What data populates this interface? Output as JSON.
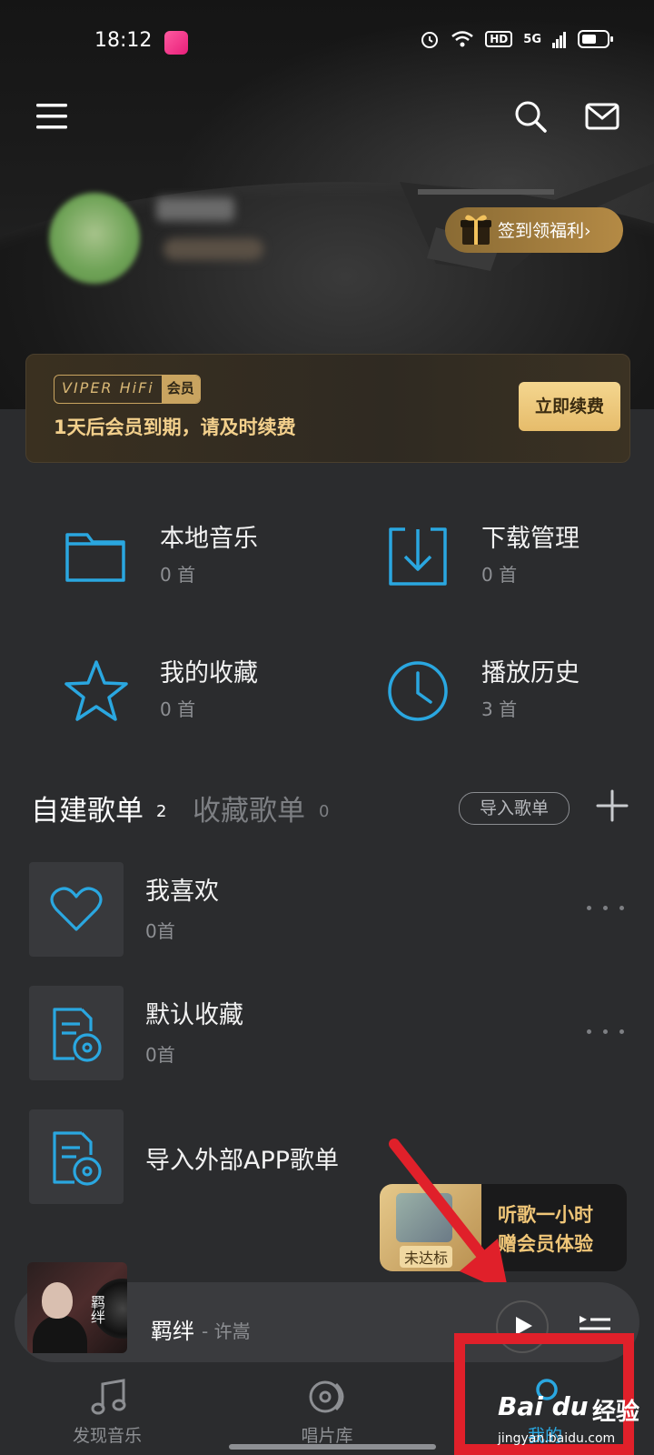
{
  "status_bar": {
    "time": "18:12",
    "hd_label": "HD",
    "network_label": "5G"
  },
  "user": {
    "checkin_label": "签到领福利"
  },
  "vip": {
    "logo_text": "VIPER HiFi",
    "logo_badge": "会员",
    "expiry_text": "1天后会员到期，请及时续费",
    "renew_label": "立即续费"
  },
  "quick_access": [
    {
      "title": "本地音乐",
      "count": "0 首",
      "icon": "folder-icon"
    },
    {
      "title": "下载管理",
      "count": "0 首",
      "icon": "download-icon"
    },
    {
      "title": "我的收藏",
      "count": "0 首",
      "icon": "star-icon"
    },
    {
      "title": "播放历史",
      "count": "3 首",
      "icon": "clock-icon"
    }
  ],
  "playlist_tabs": {
    "self_label": "自建歌单",
    "self_count": "2",
    "fav_label": "收藏歌单",
    "fav_count": "0",
    "import_label": "导入歌单"
  },
  "playlists": [
    {
      "title": "我喜欢",
      "count": "0首",
      "icon": "heart-icon"
    },
    {
      "title": "默认收藏",
      "count": "0首",
      "icon": "playlist-disc-icon"
    },
    {
      "title": "导入外部APP歌单",
      "count": "",
      "icon": "playlist-disc-icon"
    }
  ],
  "promo": {
    "badge": "未达标",
    "line1": "听歌一小时",
    "line2": "赠会员体验"
  },
  "player": {
    "song_title": "羁绊",
    "artist": " - 许嵩",
    "cover_text": "羁绊"
  },
  "bottom_nav": [
    {
      "label": "发现音乐",
      "icon": "music-note-icon"
    },
    {
      "label": "唱片库",
      "icon": "vinyl-icon"
    },
    {
      "label": "我的",
      "icon": "profile-icon"
    }
  ],
  "watermark": {
    "main": "Bai du",
    "cn": "经验",
    "sub": "jingyan.baidu.com"
  },
  "colors": {
    "accent_blue": "#2aa7e0",
    "gold": "#f0c678",
    "annotation_red": "#e0202a",
    "background": "#2b2c2e"
  }
}
